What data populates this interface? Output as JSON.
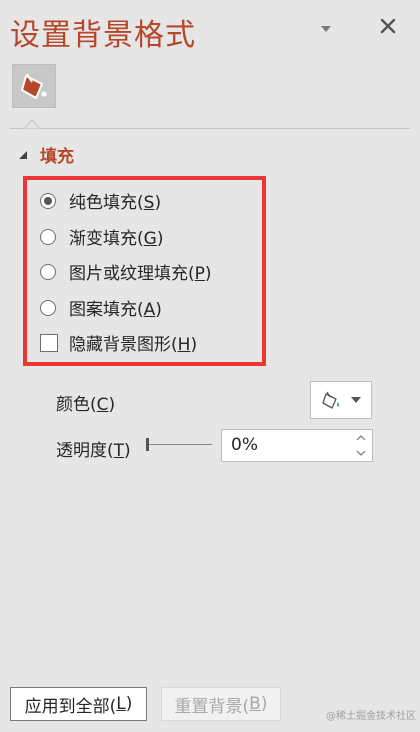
{
  "pane": {
    "title": "设置背景格式",
    "dropdown_icon": "chevron-down-icon",
    "close_icon": "close-icon",
    "category_icon": "paint-bucket-icon"
  },
  "fill": {
    "section_label": "填充",
    "options": [
      {
        "text": "纯色填充(",
        "key": "S",
        "tail": ")",
        "type": "radio",
        "checked": true
      },
      {
        "text": "渐变填充(",
        "key": "G",
        "tail": ")",
        "type": "radio",
        "checked": false
      },
      {
        "text": "图片或纹理填充(",
        "key": "P",
        "tail": ")",
        "type": "radio",
        "checked": false
      },
      {
        "text": "图案填充(",
        "key": "A",
        "tail": ")",
        "type": "radio",
        "checked": false
      },
      {
        "text": "隐藏背景图形(",
        "key": "H",
        "tail": ")",
        "type": "checkbox",
        "checked": false
      }
    ],
    "color": {
      "label": "颜色(",
      "key": "C",
      "tail": ")"
    },
    "transparency": {
      "label": "透明度(",
      "key": "T",
      "tail": ")",
      "value": "0%",
      "level": 0
    }
  },
  "buttons": {
    "apply": {
      "text": "应用到全部(",
      "key": "L",
      "tail": ")"
    },
    "reset": {
      "text": "重置背景(",
      "key": "B",
      "tail": ")"
    }
  },
  "watermark": "@稀土掘金技术社区",
  "colors": {
    "accent": "#b7472a",
    "highlight": "#ee3535",
    "panel": "#e6e6e6"
  }
}
